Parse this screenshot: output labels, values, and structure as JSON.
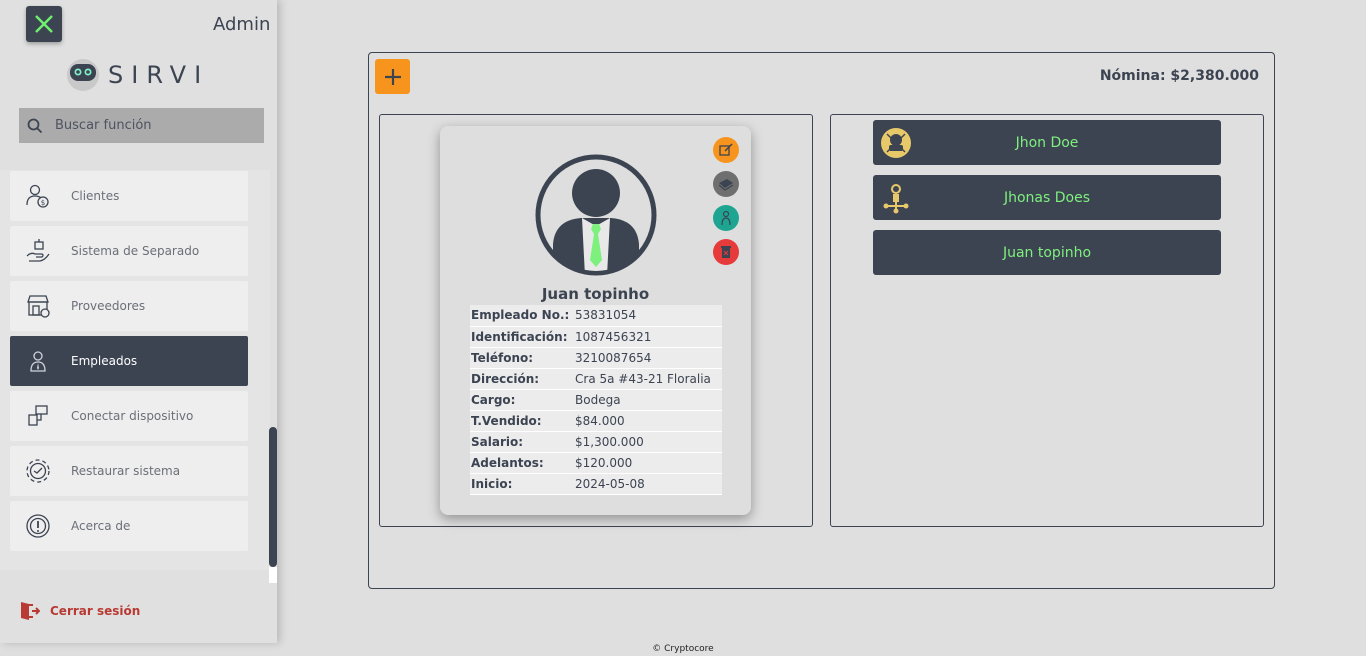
{
  "header": {
    "role_label": "Admin"
  },
  "brand": {
    "name": "SIRVI"
  },
  "search": {
    "placeholder": "Buscar función"
  },
  "sidebar": {
    "items": [
      {
        "label": "Clientes",
        "icon": "clients-icon"
      },
      {
        "label": "Sistema de Separado",
        "icon": "hand-box-icon"
      },
      {
        "label": "Proveedores",
        "icon": "store-icon"
      },
      {
        "label": "Empleados",
        "icon": "employee-icon",
        "active": true
      },
      {
        "label": "Conectar dispositivo",
        "icon": "devices-icon"
      },
      {
        "label": "Restaurar sistema",
        "icon": "gear-icon"
      },
      {
        "label": "Acerca de",
        "icon": "info-icon"
      }
    ],
    "logout_label": "Cerrar sesión"
  },
  "main": {
    "nomina": "Nómina: $2,380.000"
  },
  "employee_card": {
    "name": "Juan topinho",
    "fields": [
      {
        "label": "Empleado No.:",
        "value": "53831054"
      },
      {
        "label": "Identificación:",
        "value": "1087456321"
      },
      {
        "label": "Teléfono:",
        "value": "3210087654"
      },
      {
        "label": "Dirección:",
        "value": "Cra 5a #43-21 Floralia"
      },
      {
        "label": "Cargo:",
        "value": "Bodega"
      },
      {
        "label": "T.Vendido:",
        "value": "$84.000"
      },
      {
        "label": "Salario:",
        "value": "$1,300.000"
      },
      {
        "label": "Adelantos:",
        "value": "$120.000"
      },
      {
        "label": "Inicio:",
        "value": "2024-05-08"
      }
    ]
  },
  "employee_list": [
    {
      "name": "Jhon Doe"
    },
    {
      "name": "Jhonas Does"
    },
    {
      "name": "Juan topinho"
    }
  ],
  "colors": {
    "dark": "#3c4452",
    "accent_orange": "#f7941d",
    "name_green": "#7ef07e",
    "logout_red": "#b83a32"
  },
  "footer": {
    "text": "© Cryptocore"
  }
}
